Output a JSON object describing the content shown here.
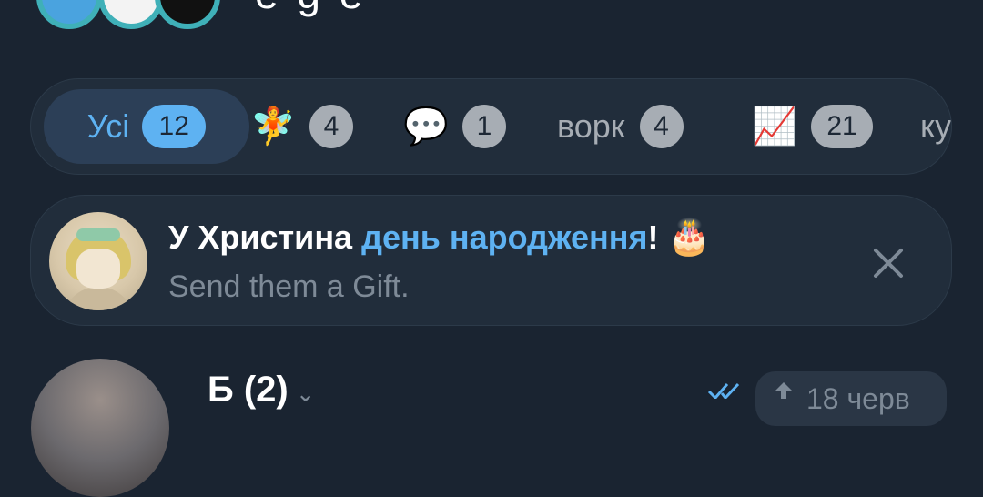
{
  "header": {
    "title_fragment": "e g e",
    "icons": [
      "avatar-stack",
      "search-icon",
      "menu-icon"
    ]
  },
  "folders": [
    {
      "label": "Усі",
      "count": "12",
      "active": true
    },
    {
      "icon": "🧚",
      "icon_name": "fairy-icon",
      "count": "4"
    },
    {
      "icon": "💬",
      "icon_name": "speech-bubble-icon",
      "count": "1"
    },
    {
      "label": "ворк",
      "count": "4"
    },
    {
      "icon": "📈",
      "icon_name": "chart-increasing-icon",
      "count": "21"
    },
    {
      "label": "ку"
    }
  ],
  "birthday_banner": {
    "prefix": "У Христина ",
    "link_text": "день народження",
    "suffix": "!",
    "emoji": "🎂",
    "subtitle": "Send them a Gift."
  },
  "chat": {
    "name": "Б (2)",
    "mute_icon": "chevron-icon",
    "time": "18 черв"
  },
  "colors": {
    "background": "#1a2431",
    "panel": "#212d3b",
    "accent": "#5eb2f2",
    "muted": "#7e8a97"
  }
}
